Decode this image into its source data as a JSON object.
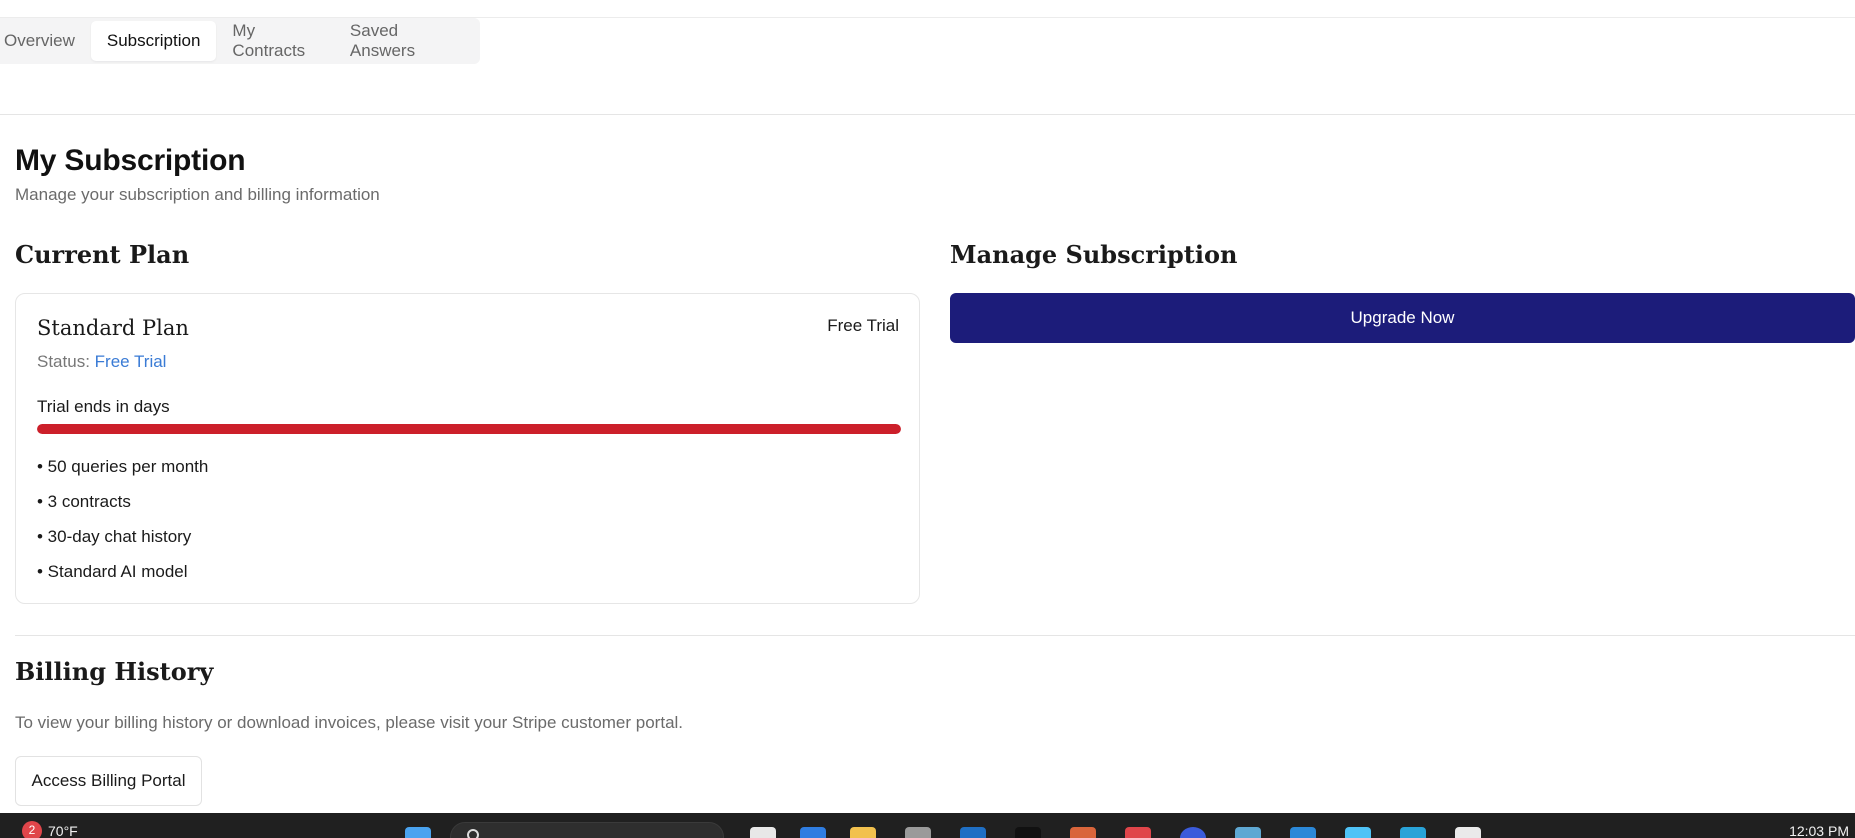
{
  "tabs": [
    {
      "label": "Overview",
      "active": false
    },
    {
      "label": "Subscription",
      "active": true
    },
    {
      "label": "My Contracts",
      "active": false
    },
    {
      "label": "Saved Answers",
      "active": false
    }
  ],
  "header": {
    "title": "My Subscription",
    "subtitle": "Manage your subscription and billing information"
  },
  "current_plan": {
    "heading": "Current Plan",
    "plan_name": "Standard Plan",
    "badge": "Free Trial",
    "status_label": "Status:",
    "status_value": "Free Trial",
    "trial_text": "Trial ends in days",
    "trial_progress_percent": 100,
    "features": [
      "• 50 queries per month",
      "• 3 contracts",
      "• 30-day chat history",
      "• Standard AI model"
    ]
  },
  "manage": {
    "heading": "Manage Subscription",
    "upgrade_label": "Upgrade Now"
  },
  "billing": {
    "heading": "Billing History",
    "text": "To view your billing history or download invoices, please visit your Stripe customer portal.",
    "portal_label": "Access Billing Portal"
  },
  "taskbar": {
    "notification_count": "2",
    "weather": "70°F",
    "clock": "12:03 PM"
  },
  "colors": {
    "accent": "#1c1c7a",
    "progress": "#cc1f2a",
    "status_link": "#3a7bd5"
  }
}
